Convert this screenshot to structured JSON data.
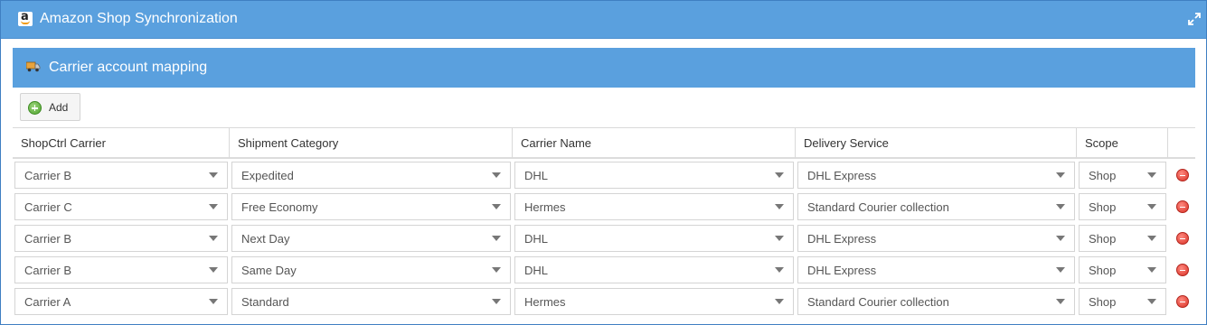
{
  "window": {
    "title": "Amazon Shop Synchronization"
  },
  "section": {
    "title": "Carrier account mapping"
  },
  "toolbar": {
    "add_label": "Add"
  },
  "columns": [
    "ShopCtrl Carrier",
    "Shipment Category",
    "Carrier Name",
    "Delivery Service",
    "Scope"
  ],
  "rows": [
    {
      "carrier": "Carrier B",
      "category": "Expedited",
      "carrier_name": "DHL",
      "service": "DHL Express",
      "scope": "Shop"
    },
    {
      "carrier": "Carrier C",
      "category": "Free Economy",
      "carrier_name": "Hermes",
      "service": "Standard Courier collection",
      "scope": "Shop"
    },
    {
      "carrier": "Carrier B",
      "category": "Next Day",
      "carrier_name": "DHL",
      "service": "DHL Express",
      "scope": "Shop"
    },
    {
      "carrier": "Carrier B",
      "category": "Same Day",
      "carrier_name": "DHL",
      "service": "DHL Express",
      "scope": "Shop"
    },
    {
      "carrier": "Carrier A",
      "category": "Standard",
      "carrier_name": "Hermes",
      "service": "Standard Courier collection",
      "scope": "Shop"
    }
  ],
  "icons": {
    "app": "amazon-logo-icon",
    "expand": "expand-icon",
    "section": "truck-icon",
    "add": "add-circle-icon",
    "delete": "remove-circle-icon",
    "dropdown": "chevron-down-icon"
  },
  "colors": {
    "header": "#5aa0de",
    "add": "#4fa32f",
    "delete": "#d93025"
  }
}
